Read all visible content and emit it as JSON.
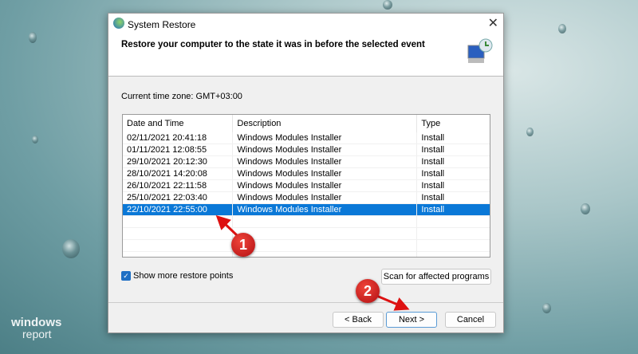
{
  "window": {
    "title": "System Restore",
    "close": "✕"
  },
  "heading": "Restore your computer to the state it was in before the selected event",
  "timezone": "Current time zone: GMT+03:00",
  "table": {
    "headers": [
      "Date and Time",
      "Description",
      "Type"
    ],
    "rows": [
      [
        "02/11/2021 20:41:18",
        "Windows Modules Installer",
        "Install"
      ],
      [
        "01/11/2021 12:08:55",
        "Windows Modules Installer",
        "Install"
      ],
      [
        "29/10/2021 20:12:30",
        "Windows Modules Installer",
        "Install"
      ],
      [
        "28/10/2021 14:20:08",
        "Windows Modules Installer",
        "Install"
      ],
      [
        "26/10/2021 22:11:58",
        "Windows Modules Installer",
        "Install"
      ],
      [
        "25/10/2021 22:03:40",
        "Windows Modules Installer",
        "Install"
      ],
      [
        "22/10/2021 22:55:00",
        "Windows Modules Installer",
        "Install"
      ]
    ],
    "selected_index": 6
  },
  "show_more": {
    "label": "Show more restore points",
    "checked": true
  },
  "buttons": {
    "scan": "Scan for affected programs",
    "back": "< Back",
    "next": "Next >",
    "cancel": "Cancel"
  },
  "annotations": [
    "1",
    "2"
  ],
  "watermark": {
    "line1": "windows",
    "line2": "report"
  }
}
